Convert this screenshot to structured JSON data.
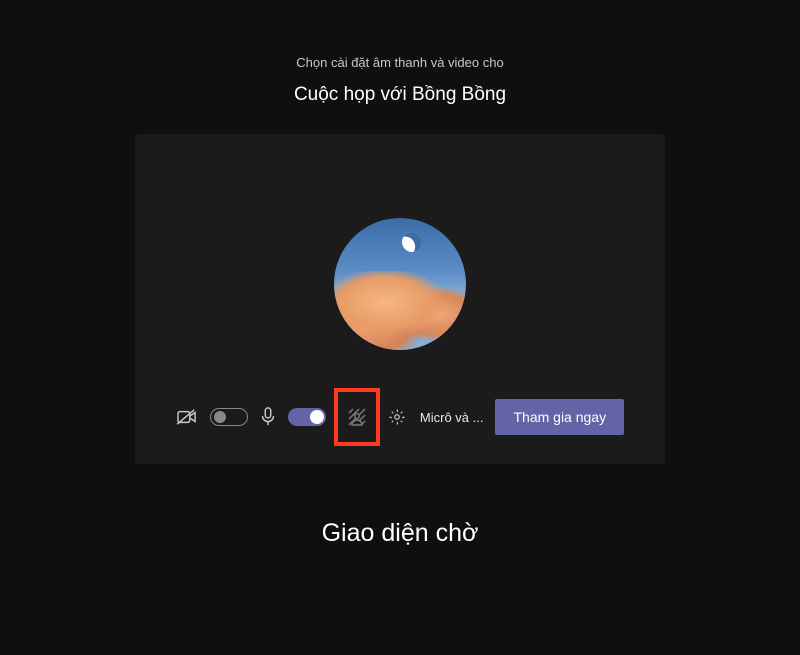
{
  "header": {
    "subtitle": "Chọn cài đặt âm thanh và video cho",
    "title": "Cuộc họp với Bồng Bồng"
  },
  "controls": {
    "camera_toggle": "off",
    "mic_toggle": "on",
    "device_label": "Micrô và ...",
    "join_label": "Tham gia ngay"
  },
  "caption": "Giao diện chờ"
}
